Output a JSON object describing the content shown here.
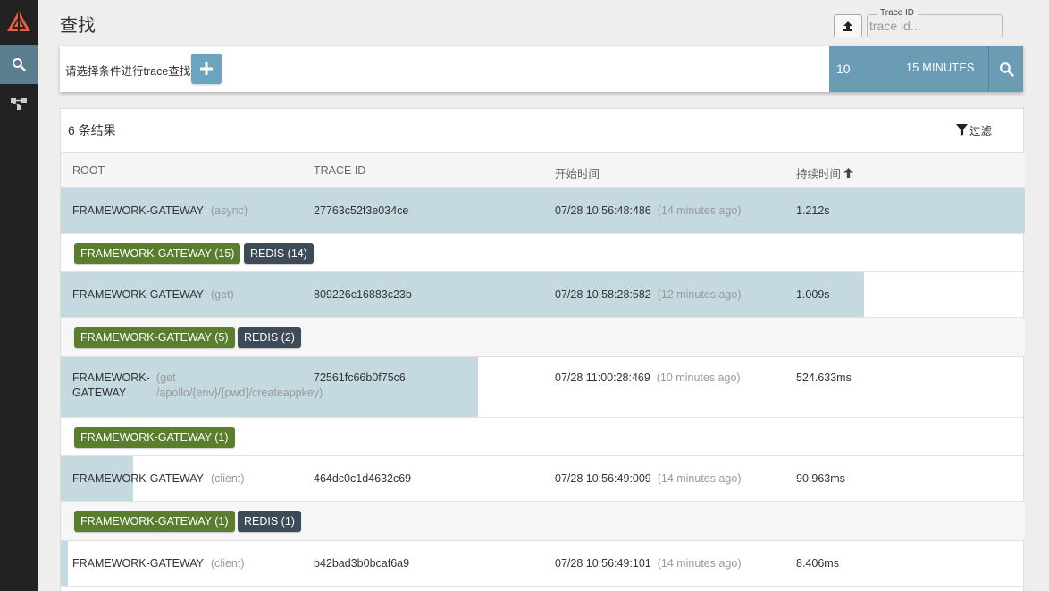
{
  "page": {
    "title": "查找"
  },
  "header": {
    "traceid_legend": "Trace ID",
    "traceid_placeholder": "trace id..."
  },
  "searchbar": {
    "hint": "请选择条件进行trace查找",
    "limit": "10",
    "lookback": "15 MINUTES"
  },
  "results": {
    "count_label": "6 条结果",
    "filter_label": "过滤",
    "columns": {
      "root": "ROOT",
      "trace_id": "TRACE ID",
      "start_time": "开始时间",
      "duration": "持续时间"
    },
    "rows": [
      {
        "root": "FRAMEWORK-GATEWAY",
        "span": "(async)",
        "trace_id": "27763c52f3e034ce",
        "start": "07/28 10:56:48:486",
        "ago": "(14 minutes ago)",
        "duration": "1.212s",
        "duration_fraction": 1.0,
        "badges": [
          {
            "label": "FRAMEWORK-GATEWAY (15)",
            "color": "#5a7d2e"
          },
          {
            "label": "REDIS (14)",
            "color": "#3d4a57"
          }
        ]
      },
      {
        "root": "FRAMEWORK-GATEWAY",
        "span": "(get)",
        "trace_id": "809226c16883c23b",
        "start": "07/28 10:58:28:582",
        "ago": "(12 minutes ago)",
        "duration": "1.009s",
        "duration_fraction": 0.833,
        "badges": [
          {
            "label": "FRAMEWORK-GATEWAY (5)",
            "color": "#5a7d2e"
          },
          {
            "label": "REDIS (2)",
            "color": "#3d4a57"
          }
        ]
      },
      {
        "root_line1": "FRAMEWORK-",
        "root_line2": "GATEWAY",
        "span_line1": "(get",
        "span_line2": "/apollo/{env}/{pwd}/createappkey)",
        "trace_id": "72561fc66b0f75c6",
        "start": "07/28 11:00:28:469",
        "ago": "(10 minutes ago)",
        "duration": "524.633ms",
        "duration_fraction": 0.433,
        "badges": [
          {
            "label": "FRAMEWORK-GATEWAY (1)",
            "color": "#5a7d2e"
          }
        ]
      },
      {
        "root": "FRAMEWORK-GATEWAY",
        "span": "(client)",
        "trace_id": "464dc0c1d4632c69",
        "start": "07/28 10:56:49:009",
        "ago": "(14 minutes ago)",
        "duration": "90.963ms",
        "duration_fraction": 0.075,
        "badges": [
          {
            "label": "FRAMEWORK-GATEWAY (1)",
            "color": "#5a7d2e"
          },
          {
            "label": "REDIS (1)",
            "color": "#3d4a57"
          }
        ]
      },
      {
        "root": "FRAMEWORK-GATEWAY",
        "span": "(client)",
        "trace_id": "b42bad3b0bcaf6a9",
        "start": "07/28 10:56:49:101",
        "ago": "(14 minutes ago)",
        "duration": "8.406ms",
        "duration_fraction": 0.007
      }
    ]
  },
  "colors": {
    "sidebar": "#222222",
    "active_nav": "#5a7d8f",
    "accent": "#6a9db5",
    "duration_bar": "#c5d9e1",
    "service_badge": "#5a7d2e",
    "redis_badge": "#3d4a57"
  },
  "icons": {
    "logo": "zipkin-logo-icon",
    "search_nav": "search-icon",
    "dependencies_nav": "dependencies-icon",
    "upload": "upload-icon",
    "add": "plus-icon",
    "search_button": "search-icon",
    "filter": "filter-icon",
    "sort": "arrow-up-icon"
  }
}
